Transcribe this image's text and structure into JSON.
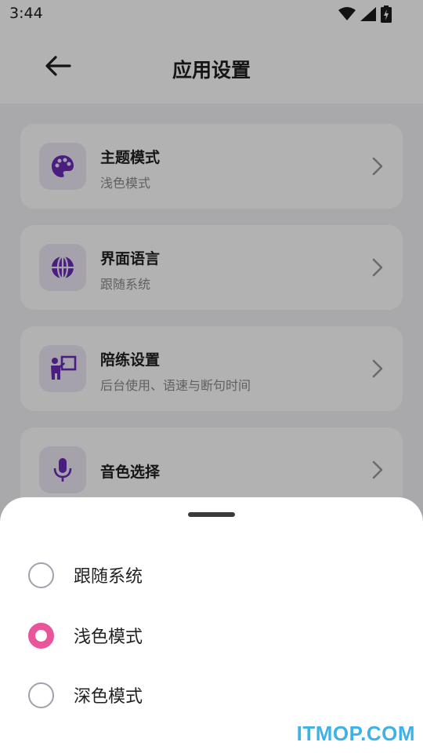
{
  "status_bar": {
    "time": "3:44",
    "icons": [
      "wifi-icon",
      "signal-icon",
      "battery-charging-icon"
    ]
  },
  "app_bar": {
    "title": "应用设置",
    "back_icon": "arrow-left-icon"
  },
  "settings": [
    {
      "title": "主题模式",
      "subtitle": "浅色模式",
      "icon": "palette-icon"
    },
    {
      "title": "界面语言",
      "subtitle": "跟随系统",
      "icon": "globe-icon"
    },
    {
      "title": "陪练设置",
      "subtitle": "后台使用、语速与断句时间",
      "icon": "teacher-board-icon"
    },
    {
      "title": "音色选择",
      "subtitle": "",
      "icon": "microphone-icon"
    }
  ],
  "theme_sheet": {
    "options": [
      {
        "label": "跟随系统",
        "selected": false
      },
      {
        "label": "浅色模式",
        "selected": true
      },
      {
        "label": "深色模式",
        "selected": false
      }
    ]
  },
  "colors": {
    "accent_icon": "#6a2bb8",
    "radio_selected": "#e8559a",
    "watermark": "#3db2e8"
  },
  "watermark": "ITMOP.COM"
}
